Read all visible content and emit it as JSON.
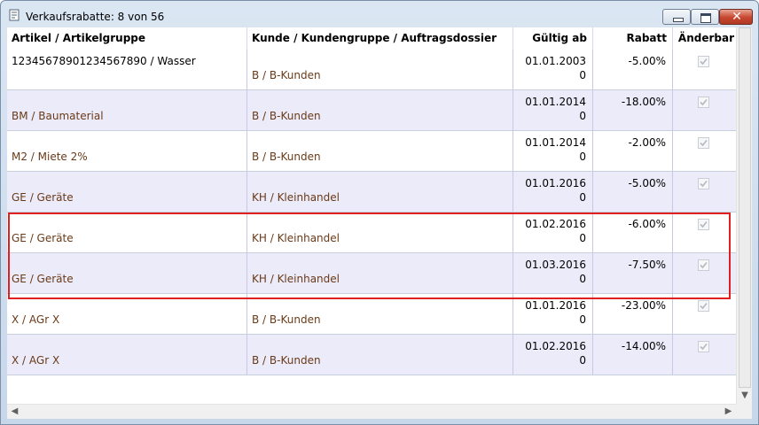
{
  "window": {
    "title": "Verkaufsrabatte: 8 von 56",
    "icon": "document-icon",
    "close_glyph": "✕"
  },
  "table": {
    "columns": [
      "Artikel / Artikelgruppe",
      "Kunde / Kundengruppe / Auftragsdossier",
      "Gültig ab",
      "Rabatt",
      "Änderbar"
    ],
    "rows": [
      {
        "artikel": "12345678901234567890 / Wasser",
        "kunde": "B / B-Kunden",
        "datum": "01.01.2003",
        "nummer": "0",
        "rabatt": "-5.00%",
        "aenderbar": true
      },
      {
        "artikel": "BM / Baumaterial",
        "kunde": "B / B-Kunden",
        "datum": "01.01.2014",
        "nummer": "0",
        "rabatt": "-18.00%",
        "aenderbar": true
      },
      {
        "artikel": "M2 / Miete 2%",
        "kunde": "B / B-Kunden",
        "datum": "01.01.2014",
        "nummer": "0",
        "rabatt": "-2.00%",
        "aenderbar": true
      },
      {
        "artikel": "GE / Geräte",
        "kunde": "KH / Kleinhandel",
        "datum": "01.01.2016",
        "nummer": "0",
        "rabatt": "-5.00%",
        "aenderbar": true
      },
      {
        "artikel": "GE / Geräte",
        "kunde": "KH / Kleinhandel",
        "datum": "01.02.2016",
        "nummer": "0",
        "rabatt": "-6.00%",
        "aenderbar": true
      },
      {
        "artikel": "GE / Geräte",
        "kunde": "KH / Kleinhandel",
        "datum": "01.03.2016",
        "nummer": "0",
        "rabatt": "-7.50%",
        "aenderbar": true
      },
      {
        "artikel": "X / AGr X",
        "kunde": "B / B-Kunden",
        "datum": "01.01.2016",
        "nummer": "0",
        "rabatt": "-23.00%",
        "aenderbar": true
      },
      {
        "artikel": "X / AGr X",
        "kunde": "B / B-Kunden",
        "datum": "01.02.2016",
        "nummer": "0",
        "rabatt": "-14.00%",
        "aenderbar": true
      }
    ]
  },
  "scrollbar": {
    "down_glyph": "▼",
    "left_glyph": "◀",
    "right_glyph": "▶"
  },
  "colors": {
    "highlight_border": "#e02020",
    "row_alt": "#ebebf9",
    "link_text": "#6a3a18"
  }
}
